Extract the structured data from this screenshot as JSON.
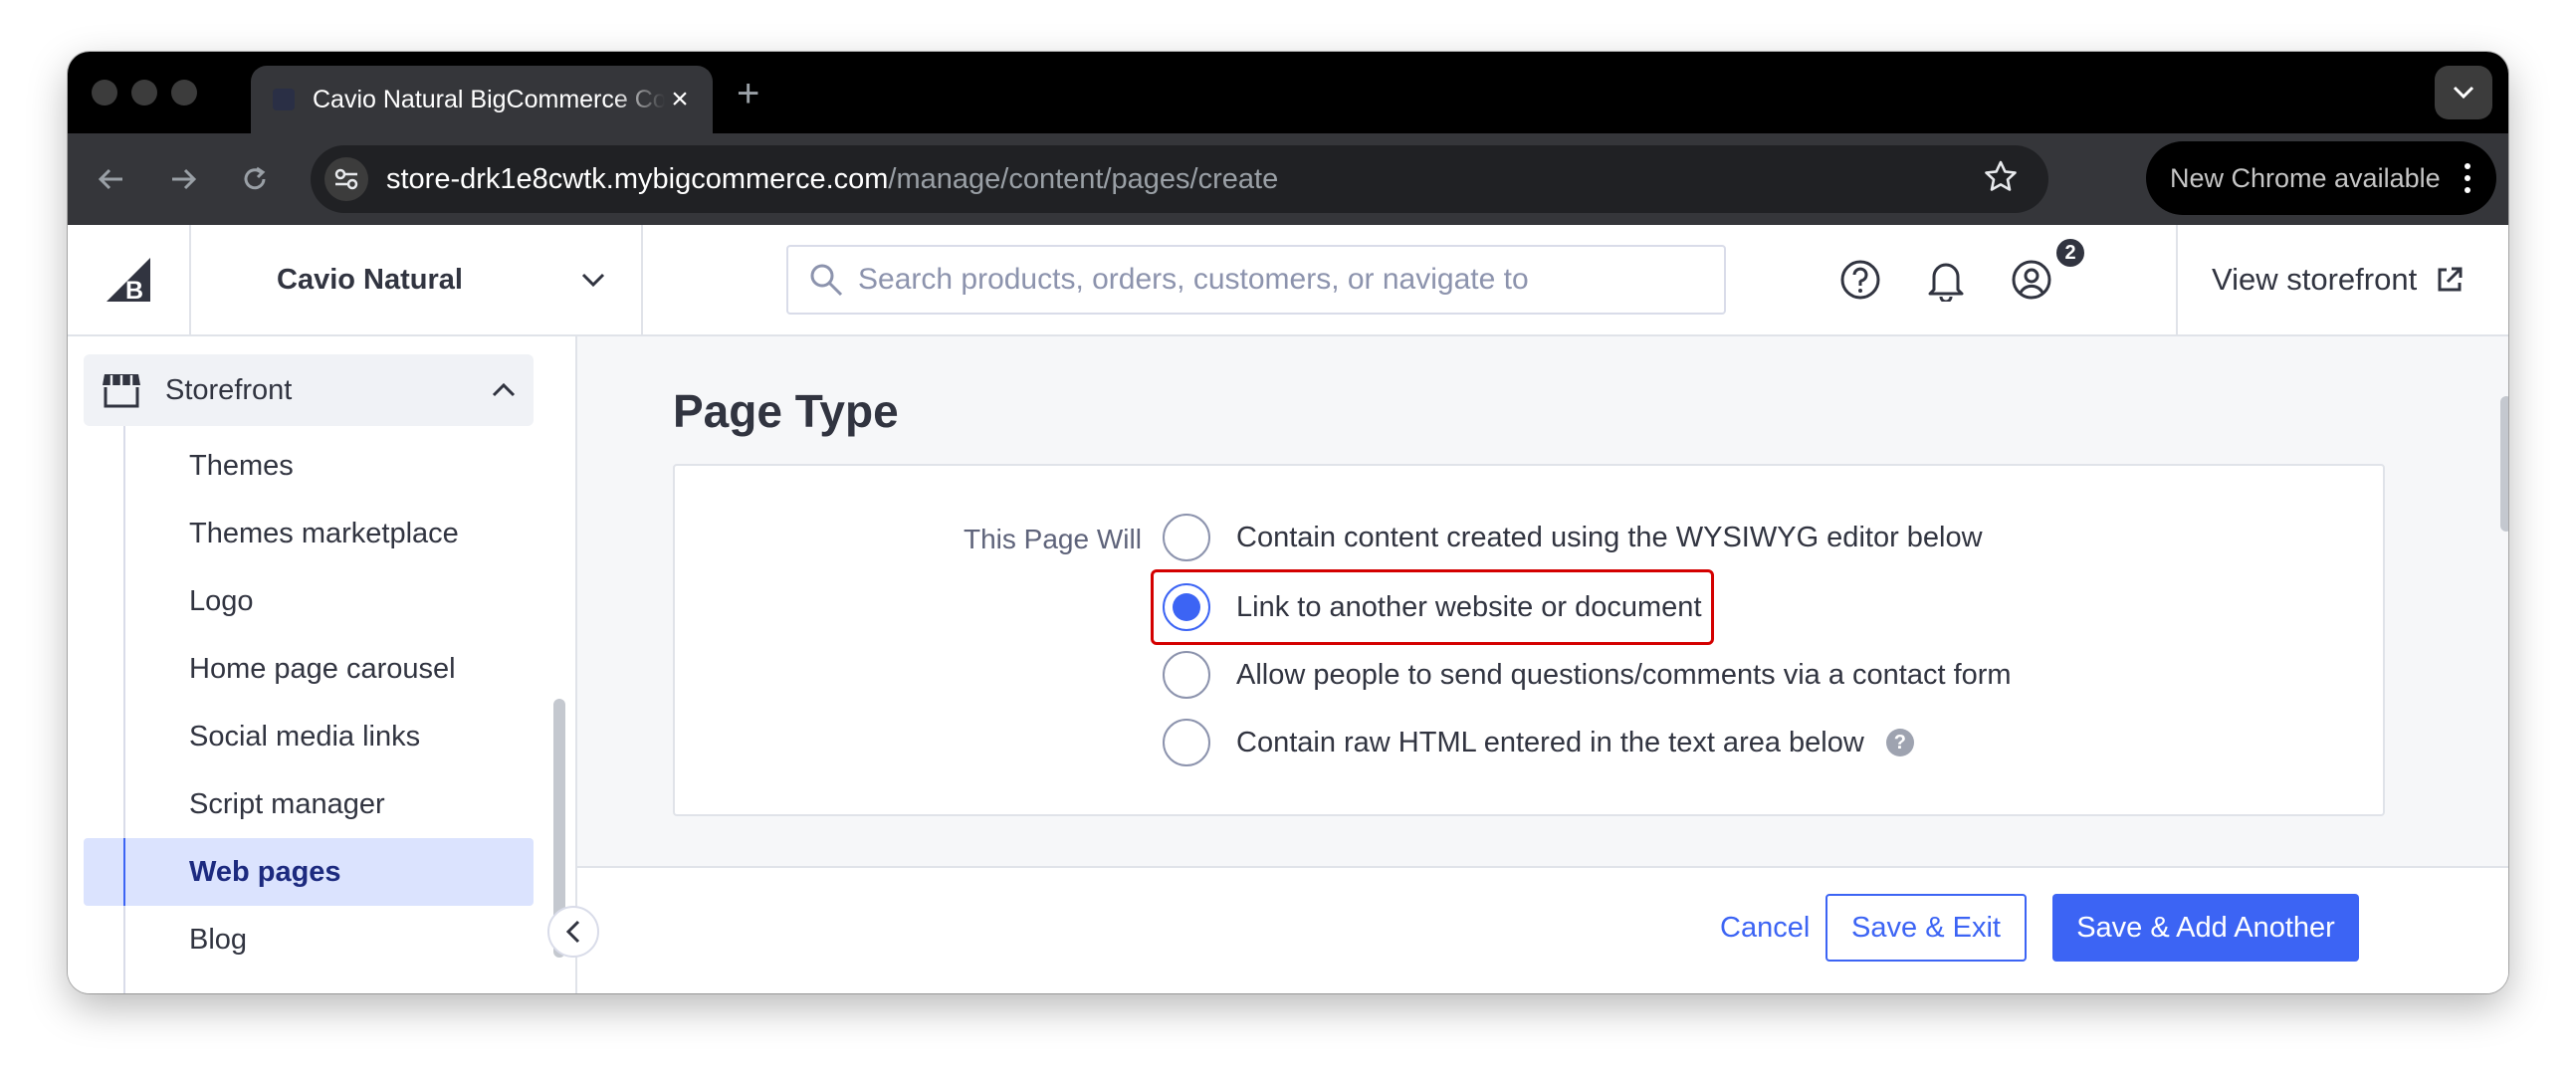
{
  "browser": {
    "tab_title": "Cavio Natural BigCommerce Control Panel",
    "url_host": "store-drk1e8cwtk.mybigcommerce.com",
    "url_path": "/manage/content/pages/create",
    "update_label": "New Chrome available",
    "icons": [
      "close-icon",
      "plus-icon",
      "chevron-down-icon",
      "back-arrow-icon",
      "forward-arrow-icon",
      "reload-icon",
      "tune-icon",
      "star-icon",
      "kebab-menu-icon"
    ]
  },
  "app": {
    "store_name": "Cavio Natural",
    "search_placeholder": "Search products, orders, customers, or navigate to",
    "notification_count": "2",
    "view_storefront_label": "View storefront"
  },
  "sidebar": {
    "section_label": "Storefront",
    "items": [
      {
        "label": "Themes",
        "active": false
      },
      {
        "label": "Themes marketplace",
        "active": false
      },
      {
        "label": "Logo",
        "active": false
      },
      {
        "label": "Home page carousel",
        "active": false
      },
      {
        "label": "Social media links",
        "active": false
      },
      {
        "label": "Script manager",
        "active": false
      },
      {
        "label": "Web pages",
        "active": true
      },
      {
        "label": "Blog",
        "active": false
      }
    ]
  },
  "main": {
    "title": "Page Type",
    "field_label": "This Page Will",
    "options": [
      {
        "label": "Contain content created using the WYSIWYG editor below",
        "checked": false
      },
      {
        "label": "Link to another website or document",
        "checked": true
      },
      {
        "label": "Allow people to send questions/comments via a contact form",
        "checked": false
      },
      {
        "label": "Contain raw HTML entered in the text area below",
        "checked": false
      }
    ],
    "help_glyph": "?",
    "actions": {
      "cancel": "Cancel",
      "save_exit": "Save & Exit",
      "save_add": "Save & Add Another"
    }
  },
  "colors": {
    "accent": "#3c64f4",
    "highlight": "#d40000",
    "text": "#313440"
  }
}
